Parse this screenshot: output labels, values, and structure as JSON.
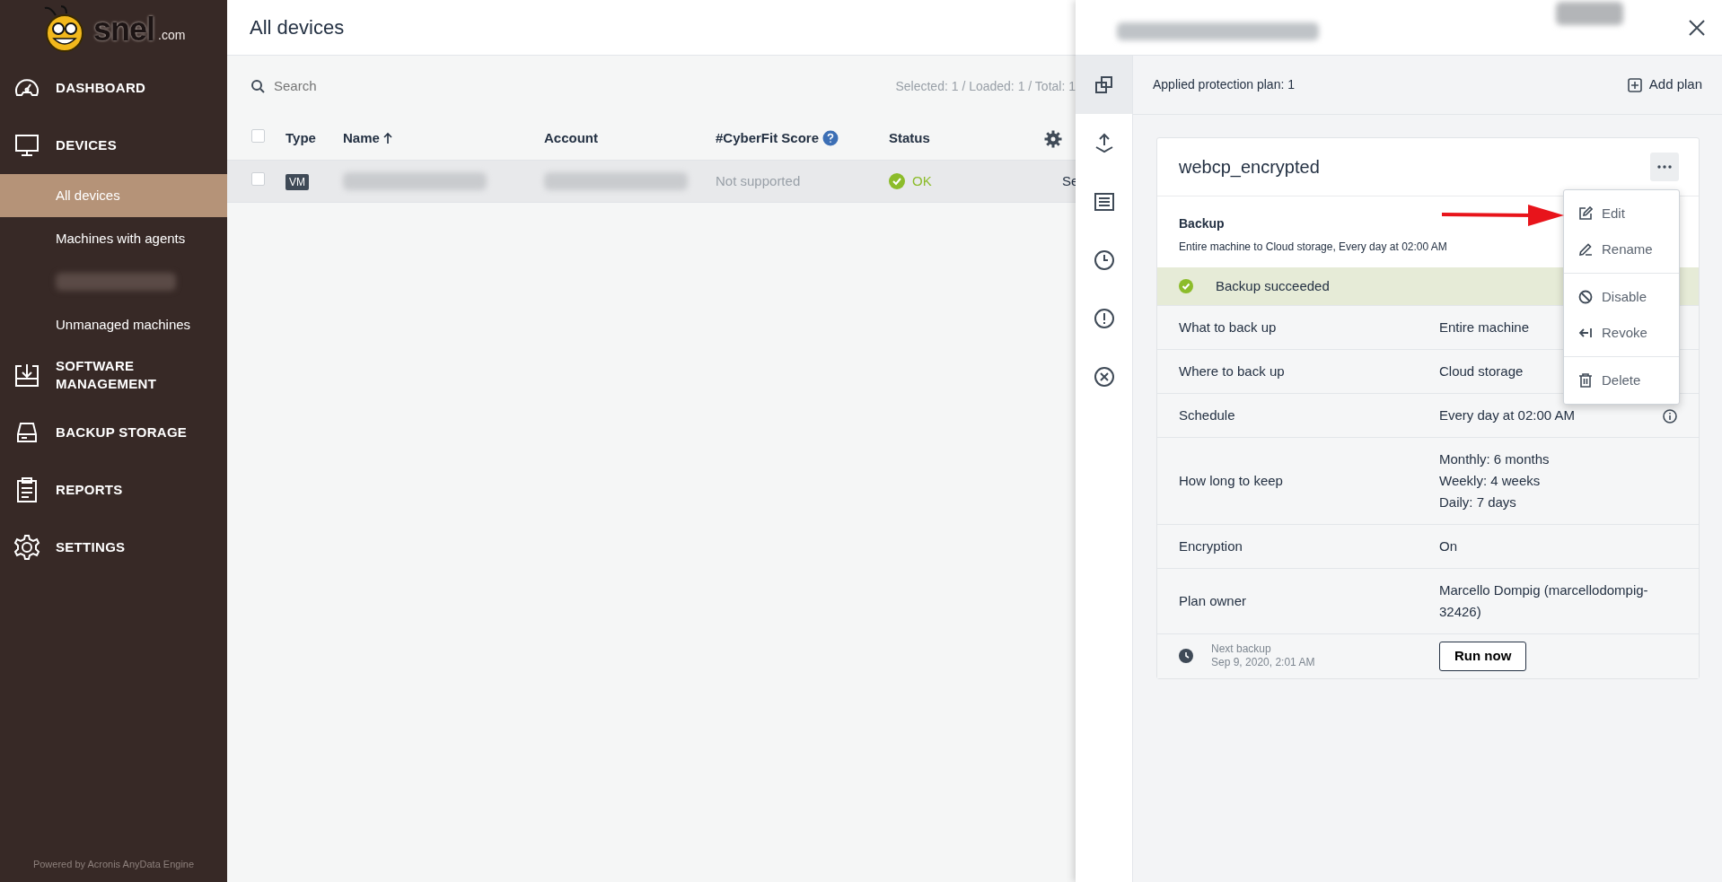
{
  "brand": {
    "name": "snel",
    "suffix": ".com"
  },
  "sidebar": {
    "items": [
      {
        "label": "DASHBOARD"
      },
      {
        "label": "DEVICES",
        "children": [
          {
            "kind": "link",
            "label": "All devices",
            "selected": true
          },
          {
            "kind": "link",
            "label": "Machines with agents",
            "selected": false
          },
          {
            "kind": "blurred",
            "selected": false
          },
          {
            "kind": "link",
            "label": "Unmanaged machines",
            "selected": false
          }
        ]
      },
      {
        "label": "SOFTWARE MANAGEMENT"
      },
      {
        "label": "BACKUP STORAGE"
      },
      {
        "label": "REPORTS"
      },
      {
        "label": "SETTINGS"
      }
    ],
    "footer": "Powered by Acronis AnyData Engine"
  },
  "main": {
    "title": "All devices",
    "search": {
      "placeholder": "Search"
    },
    "counts": "Selected: 1 / Loaded: 1 / Total: 1",
    "table": {
      "header_checked": false,
      "columns": [
        "Type",
        "Name",
        "Account",
        "#CyberFit Score",
        "Status"
      ],
      "rows": [
        {
          "selected": true,
          "checked": false,
          "type": "VM",
          "cyberfit": "Not supported",
          "status": "OK",
          "column_7": "Se"
        }
      ]
    }
  },
  "panel": {
    "tabs": [
      {
        "selected": true
      },
      {
        "selected": false
      },
      {
        "selected": false
      },
      {
        "selected": false
      },
      {
        "selected": false
      },
      {
        "selected": false
      }
    ],
    "applied": "Applied protection plan: 1",
    "add_plan": "Add plan",
    "plan": {
      "name": "webcp_encrypted",
      "section": "Backup",
      "summary": "Entire machine to Cloud storage, Every day at 02:00 AM",
      "status": "Backup succeeded",
      "details": [
        {
          "label": "What to back up",
          "values": [
            "Entire machine"
          ],
          "info": false
        },
        {
          "label": "Where to back up",
          "values": [
            "Cloud storage"
          ],
          "info": false
        },
        {
          "label": "Schedule",
          "values": [
            "Every day at 02:00 AM"
          ],
          "info": true
        },
        {
          "label": "How long to keep",
          "values": [
            "Monthly: 6 months",
            "Weekly: 4 weeks",
            "Daily: 7 days"
          ],
          "info": false
        },
        {
          "label": "Encryption",
          "values": [
            "On"
          ],
          "info": false
        },
        {
          "label": "Plan owner",
          "values": [
            "Marcello Dompig (marcellodompig-32426)"
          ],
          "info": false
        }
      ],
      "next_label": "Next backup",
      "next_time": "Sep 9, 2020, 2:01 AM",
      "run": "Run now"
    },
    "menu": [
      [
        {
          "kind": "edit",
          "label": "Edit"
        },
        {
          "kind": "rename",
          "label": "Rename"
        }
      ],
      [
        {
          "kind": "disable",
          "label": "Disable"
        },
        {
          "kind": "revoke",
          "label": "Revoke"
        }
      ],
      [
        {
          "kind": "delete",
          "label": "Delete"
        }
      ]
    ]
  }
}
